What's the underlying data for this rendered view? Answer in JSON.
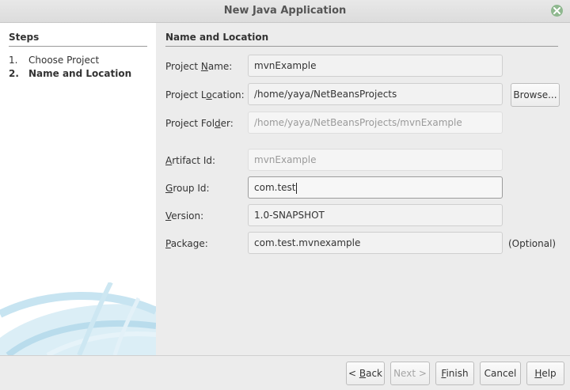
{
  "window": {
    "title": "New Java Application"
  },
  "sidebar": {
    "header": "Steps",
    "steps": [
      {
        "number": "1.",
        "label": "Choose Project"
      },
      {
        "number": "2.",
        "label": "Name and Location"
      }
    ]
  },
  "main": {
    "header": "Name and Location",
    "fields": {
      "project_name": {
        "label_pre": "Project ",
        "label_key": "N",
        "label_post": "ame:",
        "value": "mvnExample"
      },
      "project_location": {
        "label_pre": "Project L",
        "label_key": "o",
        "label_post": "cation:",
        "value": "/home/yaya/NetBeansProjects",
        "browse": "Browse..."
      },
      "project_folder": {
        "label_pre": "Project Fol",
        "label_key": "d",
        "label_post": "er:",
        "value": "/home/yaya/NetBeansProjects/mvnExample"
      },
      "artifact_id": {
        "label_pre": "",
        "label_key": "A",
        "label_post": "rtifact Id:",
        "value": "mvnExample"
      },
      "group_id": {
        "label_pre": "",
        "label_key": "G",
        "label_post": "roup Id:",
        "value": "com.test"
      },
      "version": {
        "label_pre": "",
        "label_key": "V",
        "label_post": "ersion:",
        "value": "1.0-SNAPSHOT"
      },
      "package": {
        "label_pre": "",
        "label_key": "P",
        "label_post": "ackage:",
        "value": "com.test.mvnexample",
        "hint": "(Optional)"
      }
    }
  },
  "footer": {
    "back": {
      "pre": "< ",
      "key": "B",
      "post": "ack"
    },
    "next": "Next >",
    "finish": {
      "key": "F",
      "post": "inish"
    },
    "cancel": "Cancel",
    "help": {
      "key": "H",
      "post": "elp"
    }
  },
  "colors": {
    "close_button": "#8fb88f",
    "sidebar_bg": "#ffffff",
    "dialog_bg": "#ececec"
  },
  "icons": {
    "close": "close-icon",
    "decoration": "netbeans-swoosh"
  }
}
